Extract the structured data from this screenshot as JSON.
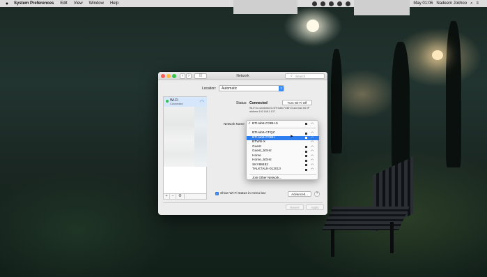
{
  "menubar": {
    "app_name": "System Preferences",
    "menus": [
      "Edit",
      "View",
      "Window",
      "Help"
    ],
    "clock": "May 01:06",
    "user": "Nadeem Jokhoo"
  },
  "window": {
    "title": "Network",
    "search_placeholder": "Search",
    "back_glyph": "‹",
    "forward_glyph": "›",
    "grid_glyph": "⁞⁞⁞"
  },
  "location": {
    "label": "Location:",
    "value": "Automatic"
  },
  "sidebar": {
    "items": [
      {
        "name": "Wi-Fi",
        "status": "Connected",
        "status_color": "#2ec24a"
      }
    ],
    "buttons": [
      "+",
      "−",
      "⚙"
    ]
  },
  "main": {
    "status_label": "Status:",
    "status_value": "Connected",
    "turn_off_label": "Turn Wi-Fi Off",
    "status_desc": "Wi-Fi is connected to BTHub6-FGBH-5 and has the IP address 192.168.1.137.",
    "network_name_label": "Network Name",
    "networks": [
      {
        "name": "BTHub6-FGBH-5",
        "checked": true,
        "locked": true,
        "selected": false
      },
      {
        "name": "BTHub6-CFQZ",
        "checked": false,
        "locked": true,
        "selected": false
      },
      {
        "name": "BTHub6-FGBH",
        "checked": false,
        "locked": true,
        "selected": true
      },
      {
        "name": "BTWifi-X",
        "checked": false,
        "locked": false,
        "selected": false
      },
      {
        "name": "Guest",
        "checked": false,
        "locked": true,
        "selected": false
      },
      {
        "name": "Guest_5GHz",
        "checked": false,
        "locked": true,
        "selected": false
      },
      {
        "name": "Home",
        "checked": false,
        "locked": true,
        "selected": false
      },
      {
        "name": "Home_5GHz",
        "checked": false,
        "locked": true,
        "selected": false
      },
      {
        "name": "SKY88482",
        "checked": false,
        "locked": true,
        "selected": false
      },
      {
        "name": "TALKTALK-012013",
        "checked": false,
        "locked": true,
        "selected": false
      }
    ],
    "join_other": "Join Other Network...",
    "show_wifi_label": "Show Wi-Fi status in menu bar",
    "show_wifi_checked": true,
    "advanced_label": "Advanced...",
    "help_label": "?",
    "revert_label": "Revert",
    "apply_label": "Apply"
  },
  "colors": {
    "accent": "#2f7ef0",
    "selection_bg": "#d6e6fb"
  }
}
